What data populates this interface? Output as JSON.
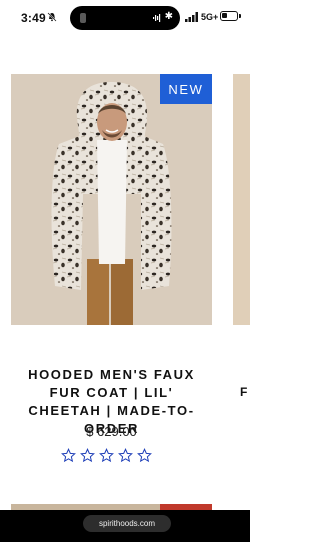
{
  "status_bar": {
    "time": "3:49",
    "network": "5G+"
  },
  "product": {
    "badge": "NEW",
    "title": "HOODED MEN'S FAUX FUR COAT | LIL' CHEETAH | MADE-TO-ORDER",
    "price": "$ 629.00",
    "rating_stars_filled": 0,
    "rating_stars_total": 5
  },
  "next_product": {
    "title_fragment": "F"
  },
  "browser": {
    "url": "spirithoods.com"
  },
  "colors": {
    "badge_blue": "#1f5fd6",
    "star_outline": "#1f3fb8"
  }
}
